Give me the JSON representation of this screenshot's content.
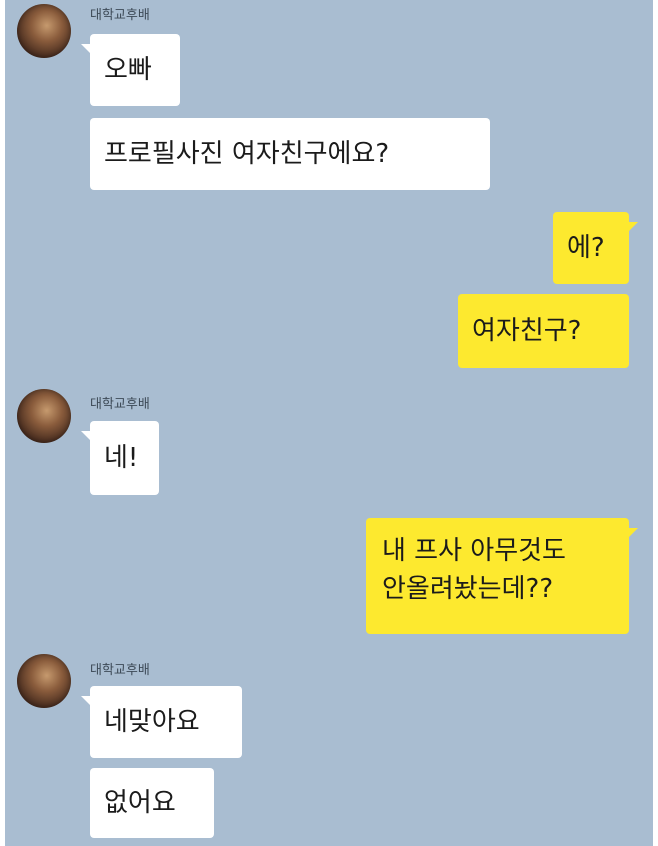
{
  "conversation": {
    "sender_name": "대학교후배",
    "groups": [
      {
        "side": "incoming",
        "messages": [
          "오빠",
          "프로필사진 여자친구에요?"
        ]
      },
      {
        "side": "outgoing",
        "messages": [
          "에?",
          "여자친구?"
        ]
      },
      {
        "side": "incoming",
        "messages": [
          "네!"
        ]
      },
      {
        "side": "outgoing",
        "messages": [
          "내 프사 아무것도\n안올려놨는데??"
        ]
      },
      {
        "side": "incoming",
        "messages": [
          "네맞아요",
          "없어요"
        ]
      }
    ]
  },
  "colors": {
    "chat_background": "#a9bdd1",
    "incoming_bubble": "#ffffff",
    "outgoing_bubble": "#fde92f"
  }
}
